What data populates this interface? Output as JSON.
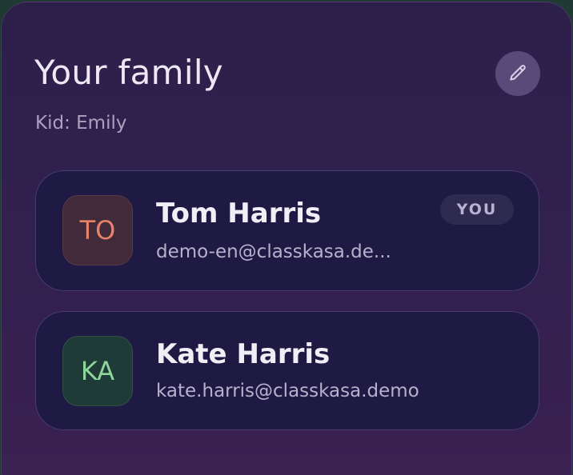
{
  "family": {
    "title": "Your family",
    "kid_label": "Kid: Emily",
    "edit_icon": "pencil-icon"
  },
  "members": [
    {
      "initials": "TO",
      "name": "Tom Harris",
      "email": "demo-en@classkasa.de...",
      "badge": "YOU",
      "avatar_text_color": "#e8826a"
    },
    {
      "initials": "KA",
      "name": "Kate Harris",
      "email": "kate.harris@classkasa.demo",
      "avatar_text_color": "#8fd49a"
    }
  ],
  "colors": {
    "card_background": "#2c1f4a",
    "member_background": "#1f1a44",
    "accent_edit_button": "#5a4a79"
  }
}
